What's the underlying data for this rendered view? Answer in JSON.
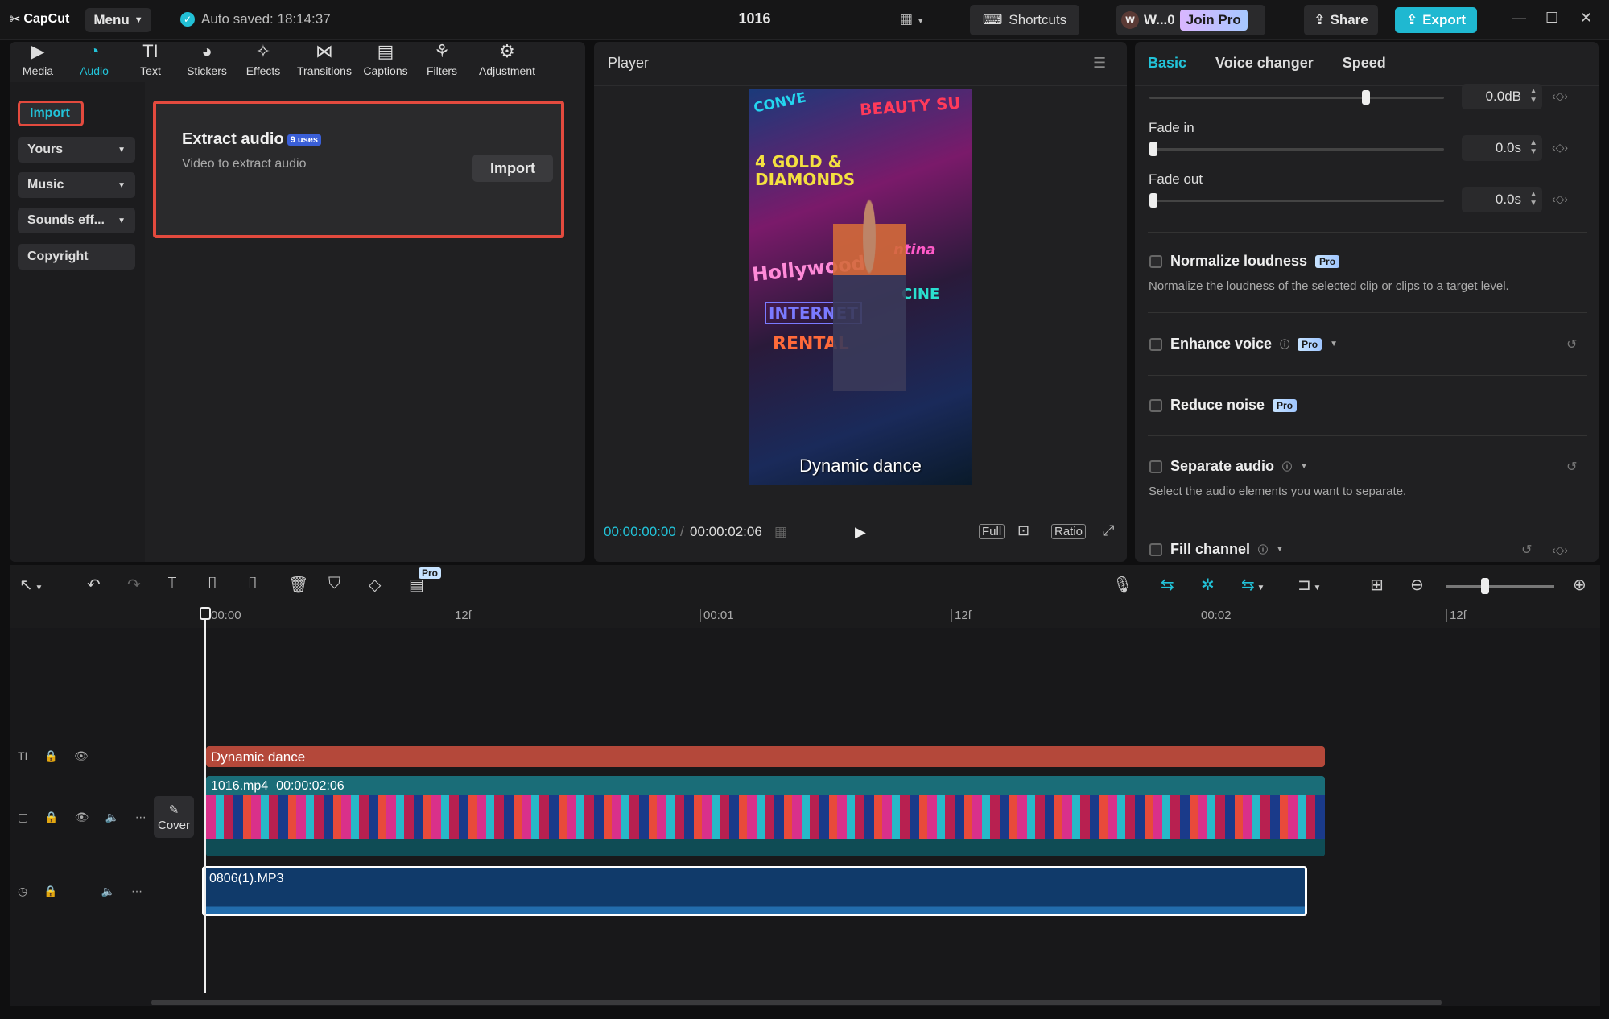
{
  "app": {
    "name": "CapCut",
    "menu_label": "Menu",
    "autosave": "Auto saved: 18:14:37",
    "project_title": "1016"
  },
  "topbar": {
    "shortcuts": "Shortcuts",
    "workspace": "W...0",
    "workspace_initial": "W",
    "join_pro": "Join Pro",
    "share": "Share",
    "export": "Export"
  },
  "left_tabs": [
    {
      "label": "Media",
      "icon": "media-icon"
    },
    {
      "label": "Audio",
      "icon": "audio-icon"
    },
    {
      "label": "Text",
      "icon": "text-icon"
    },
    {
      "label": "Stickers",
      "icon": "sticker-icon"
    },
    {
      "label": "Effects",
      "icon": "effects-icon"
    },
    {
      "label": "Transitions",
      "icon": "transitions-icon"
    },
    {
      "label": "Captions",
      "icon": "captions-icon"
    },
    {
      "label": "Filters",
      "icon": "filters-icon"
    },
    {
      "label": "Adjustment",
      "icon": "adjustment-icon"
    }
  ],
  "left_nav": {
    "import": "Import",
    "yours": "Yours",
    "music": "Music",
    "sounds": "Sounds eff...",
    "copyright": "Copyright"
  },
  "extract_card": {
    "title": "Extract audio",
    "badge": "9 uses",
    "subtitle": "Video to extract audio",
    "button": "Import"
  },
  "player": {
    "label": "Player",
    "caption": "Dynamic dance",
    "current_time": "00:00:00:00",
    "total_time": "00:00:02:06",
    "controls": {
      "full": "Full",
      "ratio": "Ratio"
    },
    "neon": [
      "BEAUTY SU",
      "4 GOLD & DIAMONDS",
      "Hollywood",
      "INTERNET",
      "RENTAL",
      "CONVE",
      "ntina",
      "CINE"
    ]
  },
  "right_panel": {
    "tabs": [
      "Basic",
      "Voice changer",
      "Speed"
    ],
    "volume_value": "0.0dB",
    "fade_in_label": "Fade in",
    "fade_in_value": "0.0s",
    "fade_out_label": "Fade out",
    "fade_out_value": "0.0s",
    "normalize": "Normalize loudness",
    "normalize_desc": "Normalize the loudness of the selected clip or clips to a target level.",
    "enhance": "Enhance voice",
    "reduce": "Reduce noise",
    "separate": "Separate audio",
    "separate_desc": "Select the audio elements you want to separate.",
    "fill": "Fill channel",
    "pro": "Pro"
  },
  "timeline": {
    "ruler": [
      "00:00",
      "12f",
      "00:01",
      "12f",
      "00:02",
      "12f"
    ],
    "text_clip": "Dynamic dance",
    "video_clip_name": "1016.mp4",
    "video_clip_duration": "00:00:02:06",
    "cover": "Cover",
    "audio_clip": "0806(1).MP3",
    "pro_badge": "Pro"
  },
  "colors": {
    "accent": "#22c3d9",
    "highlight_border": "#e34a3e",
    "text_clip": "#b4483a",
    "video_clip": "#1a6d78",
    "audio_clip": "#103a6a"
  }
}
